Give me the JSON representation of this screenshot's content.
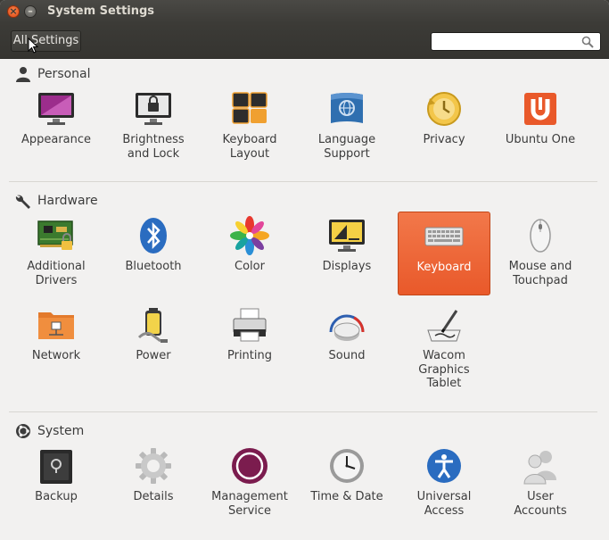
{
  "window": {
    "title": "System Settings"
  },
  "toolbar": {
    "all_settings_label": "All Settings",
    "search_value": "",
    "search_placeholder": ""
  },
  "sections": {
    "personal": {
      "title": "Personal",
      "items": [
        {
          "label": "Appearance"
        },
        {
          "label": "Brightness\nand Lock"
        },
        {
          "label": "Keyboard\nLayout"
        },
        {
          "label": "Language\nSupport"
        },
        {
          "label": "Privacy"
        },
        {
          "label": "Ubuntu One"
        }
      ]
    },
    "hardware": {
      "title": "Hardware",
      "items": [
        {
          "label": "Additional\nDrivers"
        },
        {
          "label": "Bluetooth"
        },
        {
          "label": "Color"
        },
        {
          "label": "Displays"
        },
        {
          "label": "Keyboard",
          "selected": true
        },
        {
          "label": "Mouse and\nTouchpad"
        },
        {
          "label": "Network"
        },
        {
          "label": "Power"
        },
        {
          "label": "Printing"
        },
        {
          "label": "Sound"
        },
        {
          "label": "Wacom\nGraphics\nTablet"
        }
      ]
    },
    "system": {
      "title": "System",
      "items": [
        {
          "label": "Backup"
        },
        {
          "label": "Details"
        },
        {
          "label": "Management\nService"
        },
        {
          "label": "Time & Date"
        },
        {
          "label": "Universal\nAccess"
        },
        {
          "label": "User\nAccounts"
        }
      ]
    }
  },
  "colors": {
    "accent": "#e9592a",
    "window_bg": "#f2f1f0",
    "titlebar": "#3c3b37"
  }
}
